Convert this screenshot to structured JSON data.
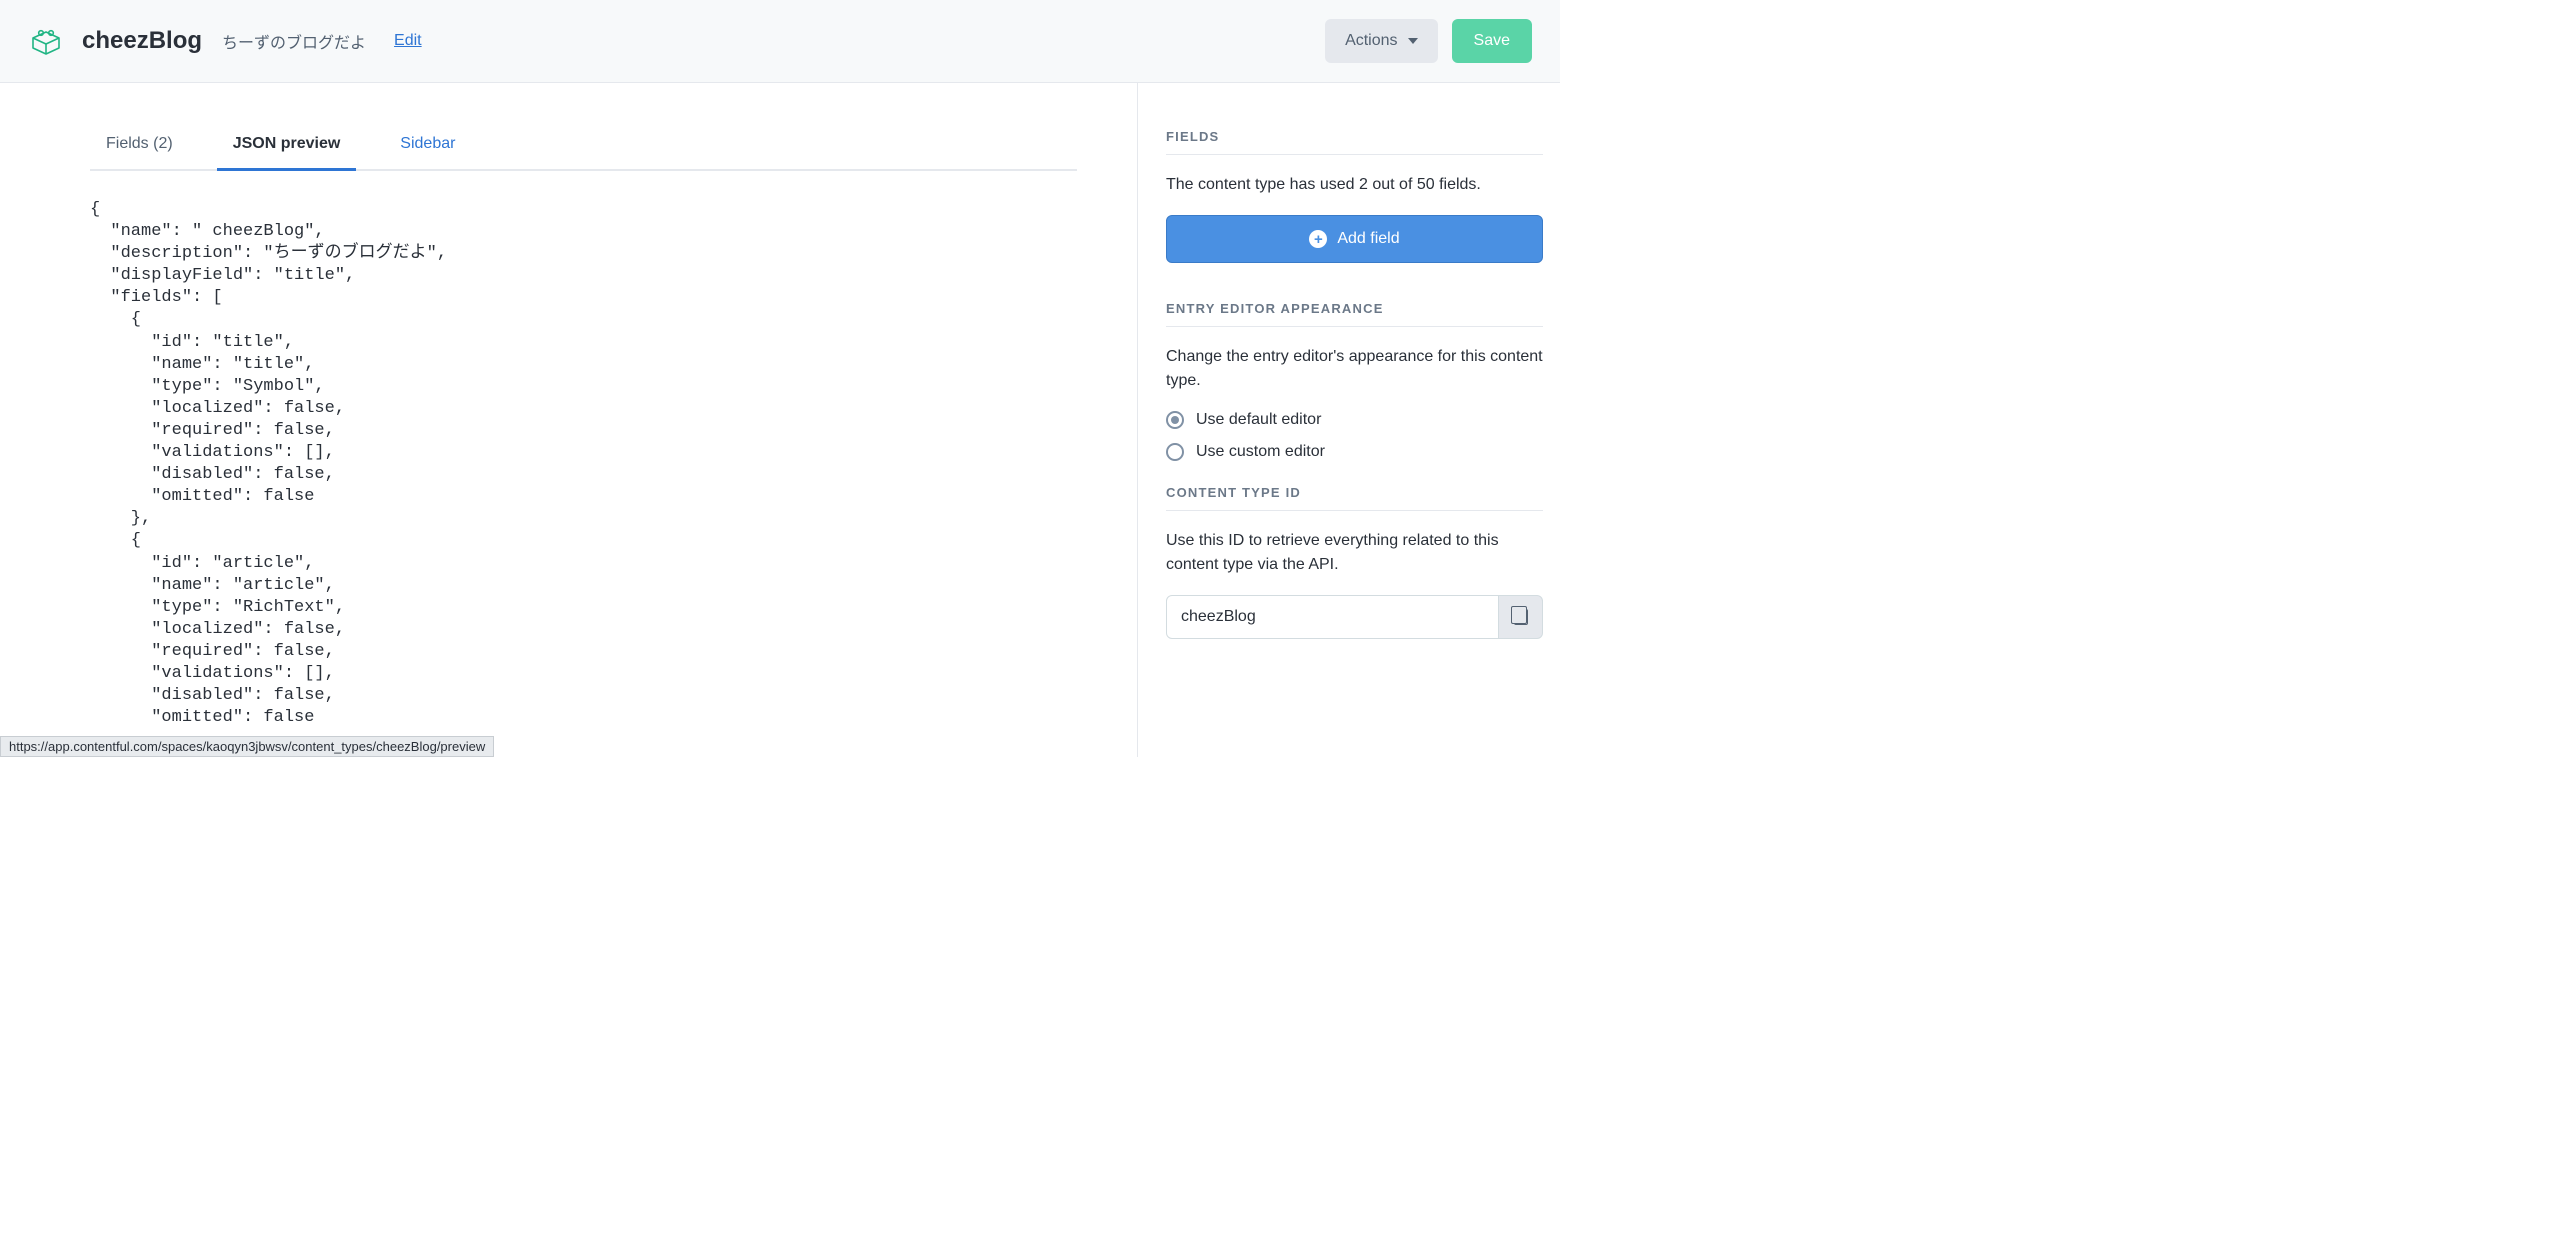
{
  "header": {
    "title": "cheezBlog",
    "description": "ちーずのブログだよ",
    "edit_label": "Edit",
    "actions_label": "Actions",
    "save_label": "Save"
  },
  "tabs": {
    "fields_label": "Fields (2)",
    "json_label": "JSON preview",
    "sidebar_label": "Sidebar"
  },
  "json_preview": "{\n  \"name\": \" cheezBlog\",\n  \"description\": \"ちーずのブログだよ\",\n  \"displayField\": \"title\",\n  \"fields\": [\n    {\n      \"id\": \"title\",\n      \"name\": \"title\",\n      \"type\": \"Symbol\",\n      \"localized\": false,\n      \"required\": false,\n      \"validations\": [],\n      \"disabled\": false,\n      \"omitted\": false\n    },\n    {\n      \"id\": \"article\",\n      \"name\": \"article\",\n      \"type\": \"RichText\",\n      \"localized\": false,\n      \"required\": false,\n      \"validations\": [],\n      \"disabled\": false,\n      \"omitted\": false",
  "sidebar": {
    "fields_heading": "FIELDS",
    "fields_text": "The content type has used 2 out of 50 fields.",
    "add_field_label": "Add field",
    "appearance_heading": "ENTRY EDITOR APPEARANCE",
    "appearance_text": "Change the entry editor's appearance for this content type.",
    "radio_default": "Use default editor",
    "radio_custom": "Use custom editor",
    "id_heading": "CONTENT TYPE ID",
    "id_text": "Use this ID to retrieve everything related to this content type via the API.",
    "id_value": "cheezBlog"
  },
  "status_url": "https://app.contentful.com/spaces/kaoqyn3jbwsv/content_types/cheezBlog/preview"
}
